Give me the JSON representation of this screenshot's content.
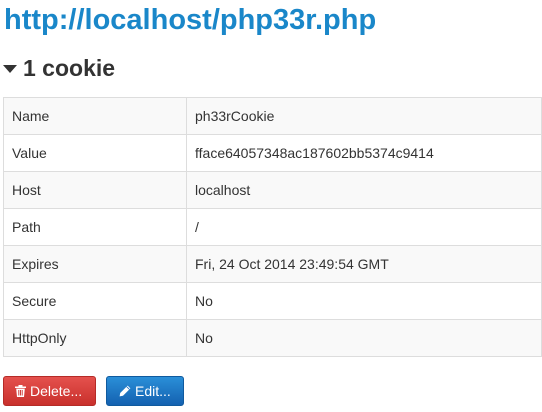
{
  "page": {
    "url": "http://localhost/php33r.php"
  },
  "cookies_section": {
    "heading": "1 cookie"
  },
  "cookie": {
    "rows": [
      {
        "key": "Name",
        "value": "ph33rCookie"
      },
      {
        "key": "Value",
        "value": "fface64057348ac187602bb5374c9414"
      },
      {
        "key": "Host",
        "value": "localhost"
      },
      {
        "key": "Path",
        "value": "/"
      },
      {
        "key": "Expires",
        "value": "Fri, 24 Oct 2014 23:49:54 GMT"
      },
      {
        "key": "Secure",
        "value": "No"
      },
      {
        "key": "HttpOnly",
        "value": "No"
      }
    ]
  },
  "actions": {
    "delete_label": "Delete...",
    "edit_label": "Edit...",
    "delete_icon": "trash-icon",
    "edit_icon": "pencil-icon",
    "delete_color": "#d9534f",
    "edit_color": "#1a6fc4"
  }
}
